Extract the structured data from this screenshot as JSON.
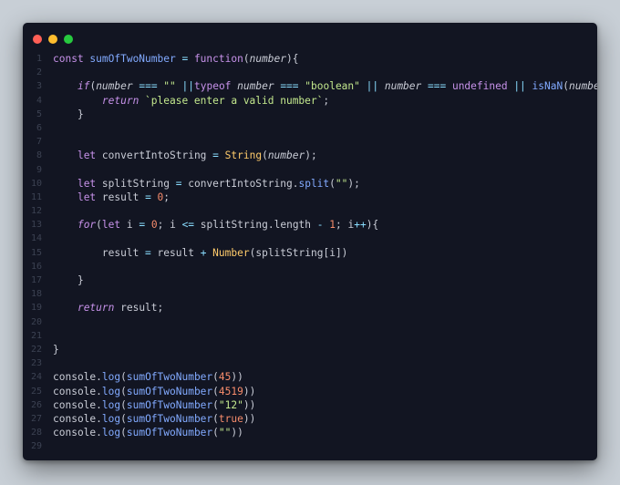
{
  "window": {
    "buttons": {
      "close_color": "#ff5f56",
      "minimize_color": "#ffbd2e",
      "maximize_color": "#27c93f"
    }
  },
  "code_lines": [
    {
      "n": "1",
      "tokens": [
        [
          "kw",
          "const "
        ],
        [
          "fn",
          "sumOfTwoNumber"
        ],
        [
          "op",
          " = "
        ],
        [
          "kw",
          "function"
        ],
        [
          "pn",
          "("
        ],
        [
          "par",
          "number"
        ],
        [
          "pn",
          "){"
        ]
      ]
    },
    {
      "n": "2",
      "tokens": []
    },
    {
      "n": "3",
      "tokens": [
        [
          "pn",
          "    "
        ],
        [
          "kwi",
          "if"
        ],
        [
          "pn",
          "("
        ],
        [
          "par",
          "number"
        ],
        [
          "op",
          " === "
        ],
        [
          "str",
          "\"\""
        ],
        [
          "op",
          " ||"
        ],
        [
          "kw",
          "typeof "
        ],
        [
          "par",
          "number"
        ],
        [
          "op",
          " === "
        ],
        [
          "str",
          "\"boolean\""
        ],
        [
          "op",
          " || "
        ],
        [
          "par",
          "number"
        ],
        [
          "op",
          " === "
        ],
        [
          "cst",
          "undefined"
        ],
        [
          "op",
          " || "
        ],
        [
          "fn",
          "isNaN"
        ],
        [
          "pn",
          "("
        ],
        [
          "par",
          "number"
        ],
        [
          "pn",
          "))"
        ],
        [
          "pn",
          "{"
        ]
      ]
    },
    {
      "n": "4",
      "tokens": [
        [
          "pn",
          "        "
        ],
        [
          "kwi",
          "return "
        ],
        [
          "str",
          "`please enter a valid number`"
        ],
        [
          "pn",
          ";"
        ]
      ]
    },
    {
      "n": "5",
      "tokens": [
        [
          "pn",
          "    }"
        ]
      ]
    },
    {
      "n": "6",
      "tokens": []
    },
    {
      "n": "7",
      "tokens": []
    },
    {
      "n": "8",
      "tokens": [
        [
          "pn",
          "    "
        ],
        [
          "kw",
          "let "
        ],
        [
          "id",
          "convertIntoString"
        ],
        [
          "op",
          " = "
        ],
        [
          "cls",
          "String"
        ],
        [
          "pn",
          "("
        ],
        [
          "par",
          "number"
        ],
        [
          "pn",
          ");"
        ]
      ]
    },
    {
      "n": "9",
      "tokens": []
    },
    {
      "n": "10",
      "tokens": [
        [
          "pn",
          "    "
        ],
        [
          "kw",
          "let "
        ],
        [
          "id",
          "splitString"
        ],
        [
          "op",
          " = "
        ],
        [
          "id",
          "convertIntoString."
        ],
        [
          "mth",
          "split"
        ],
        [
          "pn",
          "("
        ],
        [
          "str",
          "\"\""
        ],
        [
          "pn",
          "); "
        ]
      ]
    },
    {
      "n": "11",
      "tokens": [
        [
          "pn",
          "    "
        ],
        [
          "kw",
          "let "
        ],
        [
          "id",
          "result"
        ],
        [
          "op",
          " = "
        ],
        [
          "num",
          "0"
        ],
        [
          "pn",
          ";"
        ]
      ]
    },
    {
      "n": "12",
      "tokens": []
    },
    {
      "n": "13",
      "tokens": [
        [
          "pn",
          "    "
        ],
        [
          "kwi",
          "for"
        ],
        [
          "pn",
          "("
        ],
        [
          "kw",
          "let "
        ],
        [
          "id",
          "i"
        ],
        [
          "op",
          " = "
        ],
        [
          "num",
          "0"
        ],
        [
          "pn",
          "; "
        ],
        [
          "id",
          "i"
        ],
        [
          "op",
          " <= "
        ],
        [
          "id",
          "splitString.length"
        ],
        [
          "op",
          " - "
        ],
        [
          "num",
          "1"
        ],
        [
          "pn",
          "; "
        ],
        [
          "id",
          "i"
        ],
        [
          "op",
          "++"
        ],
        [
          "pn",
          "){"
        ]
      ]
    },
    {
      "n": "14",
      "tokens": []
    },
    {
      "n": "15",
      "tokens": [
        [
          "pn",
          "        "
        ],
        [
          "id",
          "result"
        ],
        [
          "op",
          " = "
        ],
        [
          "id",
          "result"
        ],
        [
          "op",
          " + "
        ],
        [
          "cls",
          "Number"
        ],
        [
          "pn",
          "("
        ],
        [
          "id",
          "splitString"
        ],
        [
          "pn",
          "["
        ],
        [
          "id",
          "i"
        ],
        [
          "pn",
          "])"
        ]
      ]
    },
    {
      "n": "16",
      "tokens": []
    },
    {
      "n": "17",
      "tokens": [
        [
          "pn",
          "    }"
        ]
      ]
    },
    {
      "n": "18",
      "tokens": []
    },
    {
      "n": "19",
      "tokens": [
        [
          "pn",
          "    "
        ],
        [
          "kwi",
          "return "
        ],
        [
          "id",
          "result"
        ],
        [
          "pn",
          ";"
        ]
      ]
    },
    {
      "n": "20",
      "tokens": []
    },
    {
      "n": "21",
      "tokens": []
    },
    {
      "n": "22",
      "tokens": [
        [
          "pn",
          "}"
        ]
      ]
    },
    {
      "n": "23",
      "tokens": []
    },
    {
      "n": "24",
      "tokens": [
        [
          "id",
          "console."
        ],
        [
          "mth",
          "log"
        ],
        [
          "pn",
          "("
        ],
        [
          "fn",
          "sumOfTwoNumber"
        ],
        [
          "pn",
          "("
        ],
        [
          "num",
          "45"
        ],
        [
          "pn",
          "))"
        ]
      ]
    },
    {
      "n": "25",
      "tokens": [
        [
          "id",
          "console."
        ],
        [
          "mth",
          "log"
        ],
        [
          "pn",
          "("
        ],
        [
          "fn",
          "sumOfTwoNumber"
        ],
        [
          "pn",
          "("
        ],
        [
          "num",
          "4519"
        ],
        [
          "pn",
          "))"
        ]
      ]
    },
    {
      "n": "26",
      "tokens": [
        [
          "id",
          "console."
        ],
        [
          "mth",
          "log"
        ],
        [
          "pn",
          "("
        ],
        [
          "fn",
          "sumOfTwoNumber"
        ],
        [
          "pn",
          "("
        ],
        [
          "str",
          "\"12\""
        ],
        [
          "pn",
          "))"
        ]
      ]
    },
    {
      "n": "27",
      "tokens": [
        [
          "id",
          "console."
        ],
        [
          "mth",
          "log"
        ],
        [
          "pn",
          "("
        ],
        [
          "fn",
          "sumOfTwoNumber"
        ],
        [
          "pn",
          "("
        ],
        [
          "num",
          "true"
        ],
        [
          "pn",
          "))"
        ]
      ]
    },
    {
      "n": "28",
      "tokens": [
        [
          "id",
          "console."
        ],
        [
          "mth",
          "log"
        ],
        [
          "pn",
          "("
        ],
        [
          "fn",
          "sumOfTwoNumber"
        ],
        [
          "pn",
          "("
        ],
        [
          "str",
          "\"\""
        ],
        [
          "pn",
          "))"
        ]
      ]
    },
    {
      "n": "29",
      "tokens": []
    }
  ]
}
